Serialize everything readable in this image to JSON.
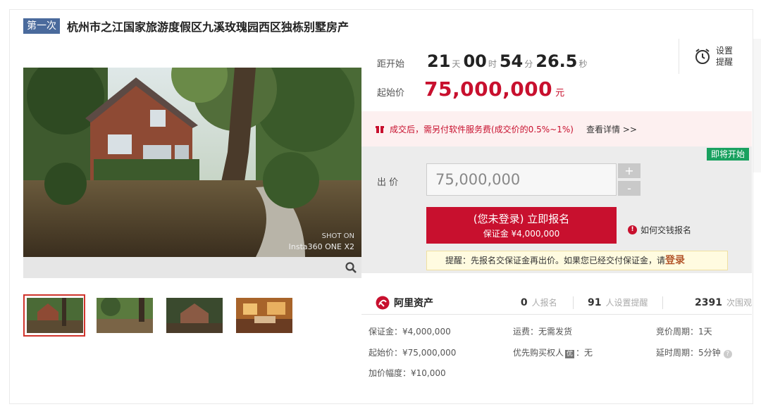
{
  "header": {
    "round_badge": "第一次",
    "title": "杭州市之江国家旅游度假区九溪玫瑰园西区独栋别墅房产"
  },
  "countdown": {
    "label": "距开始",
    "days": "21",
    "days_unit": "天",
    "hours": "00",
    "hours_unit": "时",
    "minutes": "54",
    "minutes_unit": "分",
    "seconds": "26.5",
    "seconds_unit": "秒"
  },
  "start_price": {
    "label": "起始价",
    "value": "75,000,000",
    "unit": "元"
  },
  "reminder": {
    "label": "设置\n提醒"
  },
  "notice": {
    "text": "成交后，需另付软件服务费(成交价的0.5%~1%)",
    "link": "查看详情 >>"
  },
  "bid": {
    "status_badge": "即将开始",
    "label": "出 价",
    "value": "75,000,000",
    "plus": "+",
    "minus": "-",
    "signup_main": "(您未登录) 立即报名",
    "signup_sub": "保证金 ¥4,000,000",
    "howto": "如何交钱报名",
    "tip_text": "提醒：先报名交保证金再出价。如果您已经交付保证金，请",
    "tip_login": "登录"
  },
  "brand": {
    "name": "阿里资产"
  },
  "stats": [
    {
      "num": "0",
      "label": "人报名"
    },
    {
      "num": "91",
      "label": "人设置提醒"
    },
    {
      "num": "2391",
      "label": "次围观"
    }
  ],
  "info": {
    "deposit": "保证金：¥4,000,000",
    "freight": "运费：无需发货",
    "cycle": "竞价周期：1天",
    "start": "起始价：¥75,000,000",
    "priority_a": "优先购买权人",
    "priority_badge": "优",
    "priority_b": "：无",
    "delay": "延时周期：5分钟",
    "increment": "加价幅度：¥10,000"
  },
  "photo": {
    "watermark_1": "SHOT ON",
    "watermark_2": "Insta360 ONE X2"
  },
  "colors": {
    "accent": "#c8102e",
    "badge": "#4a6a9c",
    "soon": "#19a15f"
  }
}
